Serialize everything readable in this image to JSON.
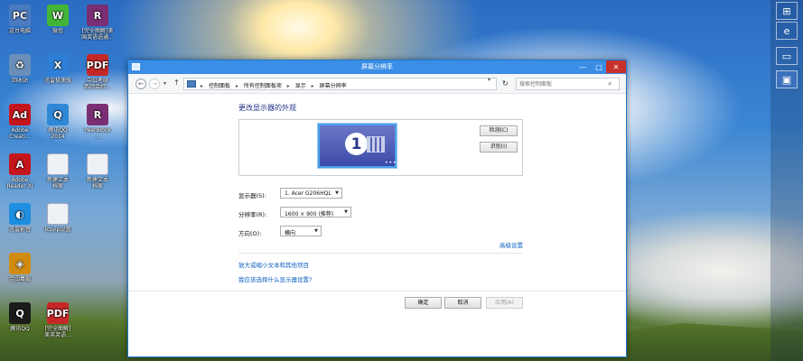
{
  "desktop": {
    "icons": [
      {
        "label": "这台电脑",
        "glyph": "PC",
        "color": "#4b7bbf"
      },
      {
        "label": "微信",
        "glyph": "W",
        "color": "#43b638"
      },
      {
        "label": "[完全图解]美\n国英语语通...",
        "glyph": "R",
        "color": "#7a2e74"
      },
      {
        "label": "回收站",
        "glyph": "♻",
        "color": "#6a8fb8"
      },
      {
        "label": "迅雷极速版",
        "glyph": "X",
        "color": "#2d7fd8"
      },
      {
        "label": "中公考研\n西综合综...",
        "glyph": "PDF",
        "color": "#c62828"
      },
      {
        "label": "Adobe\nCreati...",
        "glyph": "Ad",
        "color": "#c4161c"
      },
      {
        "label": "腾讯QQ\n2014",
        "glyph": "Q",
        "color": "#2f88d6"
      },
      {
        "label": "PeerBlock\n...",
        "glyph": "R",
        "color": "#7a2e74"
      },
      {
        "label": "Adobe\nReader XI",
        "glyph": "A",
        "color": "#c4161c"
      },
      {
        "label": "新建文本\n档案",
        "glyph": "",
        "color": "#eef2f6"
      },
      {
        "label": "新建文本\n档案",
        "glyph": "",
        "color": "#eef2f6"
      },
      {
        "label": "迅雷影音",
        "glyph": "◐",
        "color": "#1e8ee0"
      },
      {
        "label": "tcp/ip设置",
        "glyph": "",
        "color": "#eef2f6"
      },
      {
        "label": "金山毒霸",
        "glyph": "◈",
        "color": "#d18b12"
      },
      {
        "label": "腾讯QQ",
        "glyph": "Q",
        "color": "#1a1a1a"
      },
      {
        "label": "[完全图解]\n美英英语...",
        "glyph": "PDF",
        "color": "#c62828"
      }
    ]
  },
  "charms": {
    "items": [
      {
        "icon": "windows-logo-icon",
        "glyph": "⊞"
      },
      {
        "icon": "internet-explorer-icon",
        "glyph": "e"
      },
      {
        "icon": "file-explorer-icon",
        "glyph": "▭"
      },
      {
        "icon": "display-settings-icon",
        "glyph": "▣"
      }
    ]
  },
  "window": {
    "title": "屏幕分辨率",
    "minimize": "—",
    "maximize": "□",
    "close": "✕"
  },
  "address_bar": {
    "crumbs": [
      "控制面板",
      "所有控制面板项",
      "显示",
      "屏幕分辨率"
    ],
    "separator": "▸",
    "search_placeholder": "搜索控制面板"
  },
  "main": {
    "heading": "更改显示器的外观",
    "monitor_number": "1",
    "detect_button": "检测(C)",
    "identify_button": "识别(I)",
    "display_label": "显示器(S):",
    "display_value": "1. Acer G206HQL",
    "resolution_label": "分辨率(R):",
    "resolution_value": "1600 × 900 (推荐)",
    "orientation_label": "方向(O):",
    "orientation_value": "横向",
    "advanced_link": "高级设置",
    "text_size_link": "放大或缩小文本和其他项目",
    "help_link": "我应该选择什么显示器设置?"
  },
  "footer": {
    "ok": "确定",
    "cancel": "取消",
    "apply": "应用(A)"
  }
}
